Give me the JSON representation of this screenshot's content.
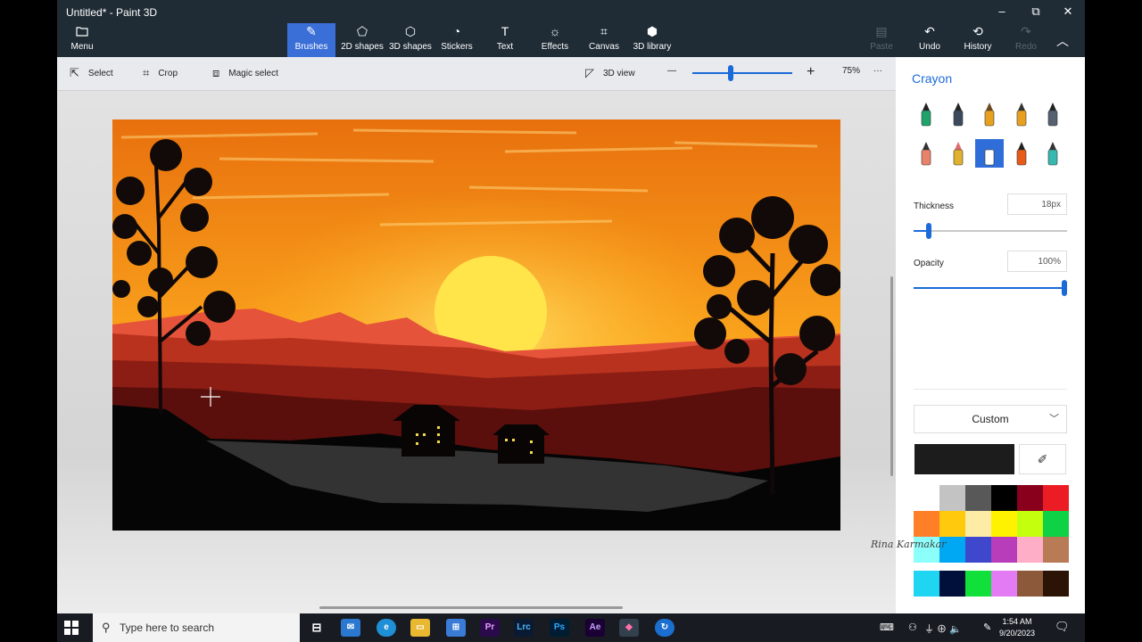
{
  "window": {
    "title": "Untitled* - Paint 3D",
    "minimize_icon": "–",
    "maximize_icon": "⧉",
    "close_icon": "✕"
  },
  "ribbon": {
    "menu_label": "Menu",
    "tabs": [
      {
        "label": "Brushes",
        "icon": "brush-icon",
        "glyph": "✎"
      },
      {
        "label": "2D shapes",
        "icon": "2d-shapes-icon",
        "glyph": "⬠"
      },
      {
        "label": "3D shapes",
        "icon": "3d-shapes-icon",
        "glyph": "⬡"
      },
      {
        "label": "Stickers",
        "icon": "stickers-icon",
        "glyph": "◔"
      },
      {
        "label": "Text",
        "icon": "text-icon",
        "glyph": "T"
      },
      {
        "label": "Effects",
        "icon": "effects-icon",
        "glyph": "☼"
      },
      {
        "label": "Canvas",
        "icon": "canvas-icon",
        "glyph": "⌗"
      },
      {
        "label": "3D library",
        "icon": "3d-library-icon",
        "glyph": "⬢"
      }
    ],
    "paste_label": "Paste",
    "undo_label": "Undo",
    "history_label": "History",
    "redo_label": "Redo"
  },
  "toolbar": {
    "select_label": "Select",
    "crop_label": "Crop",
    "magic_select_label": "Magic select",
    "view_3d_label": "3D view",
    "zoom_out": "—",
    "zoom_in": "+",
    "zoom_level": "75%",
    "more": "···",
    "zoom_fraction": 0.38
  },
  "panel": {
    "title": "Crayon",
    "thickness_label": "Thickness",
    "thickness_value": "18px",
    "thickness_fraction": 0.1,
    "opacity_label": "Opacity",
    "opacity_value": "100%",
    "opacity_fraction": 1.0,
    "color_mode": "Custom",
    "current_color": "#1c1c1c",
    "brushes": [
      "marker",
      "calligraphy-pen",
      "oil-brush",
      "watercolor",
      "pencil",
      "eraser",
      "crayon",
      "pixel-pen",
      "spray-can",
      "fill"
    ],
    "selected_brush": "pixel-pen",
    "swatches": [
      "#ffffff",
      "#c3c3c3",
      "#585858",
      "#000000",
      "#88001b",
      "#ec1c24",
      "#ff7f27",
      "#ffc90e",
      "#fdeca6",
      "#fff200",
      "#c4ff0e",
      "#0ed145",
      "#8cfffb",
      "#00a8f3",
      "#3f48cc",
      "#b83dba",
      "#ffaec8",
      "#b97a56",
      "#1fd5f2",
      "#00103a",
      "#11e03a",
      "#e27bf4",
      "#8c5a3a",
      "#2b1406"
    ]
  },
  "watermark": "Rina Karmakar",
  "taskbar": {
    "search_placeholder": "Type here to search",
    "apps": [
      "Pr",
      "Lrc",
      "Ps",
      "Ae"
    ],
    "time": "1:54 AM",
    "date": "9/20/2023"
  }
}
